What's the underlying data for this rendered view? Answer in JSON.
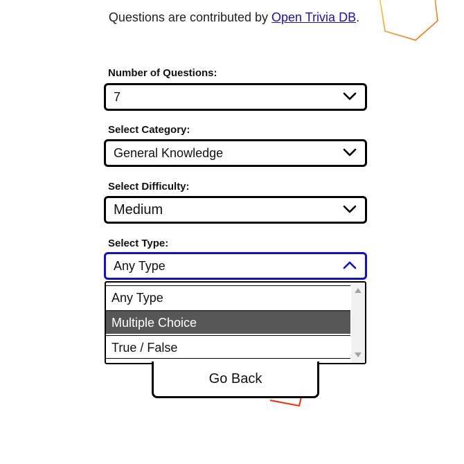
{
  "credit": {
    "prefix": "Questions are contributed by ",
    "link_text": "Open Trivia DB",
    "suffix": "."
  },
  "fields": {
    "questions": {
      "label": "Number of Questions:",
      "value": "7"
    },
    "category": {
      "label": "Select Category:",
      "value": "General Knowledge"
    },
    "difficulty": {
      "label": "Select Difficulty:",
      "value": "Medium"
    },
    "type": {
      "label": "Select Type:",
      "value": "Any Type"
    }
  },
  "type_options": [
    "Any Type",
    "Multiple Choice",
    "True / False"
  ],
  "highlighted_option": "Multiple Choice",
  "go_back_label": "Go Back",
  "colors": {
    "focus_border": "#1010d0",
    "link": "#1a0dcc",
    "highlight_bg": "#575757",
    "deco_orange": "#ff9a1f",
    "deco_red": "#ff2a00"
  },
  "icons": {
    "select_arrow": "chevron-down-icon",
    "open_arrow": "chevron-up-icon"
  }
}
